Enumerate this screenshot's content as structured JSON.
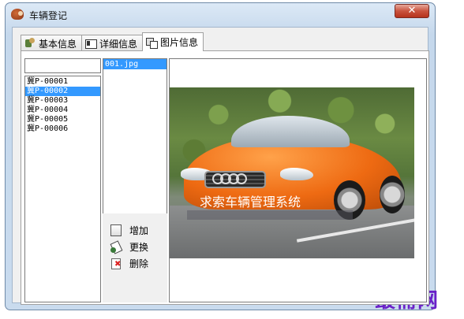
{
  "window": {
    "title": "车辆登记",
    "close_symbol": "✕"
  },
  "tabs": [
    {
      "label": "基本信息",
      "icon": "basic-info-icon",
      "active": false
    },
    {
      "label": "详细信息",
      "icon": "detail-info-icon",
      "active": false
    },
    {
      "label": "图片信息",
      "icon": "picture-info-icon",
      "active": true
    }
  ],
  "search": {
    "value": "",
    "placeholder": ""
  },
  "plates": [
    "冀P-00001",
    "冀P-00002",
    "冀P-00003",
    "冀P-00004",
    "冀P-00005",
    "冀P-00006"
  ],
  "selected_plate": "冀P-00002",
  "files": [
    "001.jpg"
  ],
  "actions": {
    "add_label": "增加",
    "change_label": "更换",
    "delete_label": "删除"
  },
  "preview": {
    "watermark": "求索车辆管理系统"
  },
  "brand_mark": "最需网",
  "colors": {
    "selection": "#3399ff",
    "car": "#ee6a12",
    "brand_mark": "#6a21c8"
  }
}
